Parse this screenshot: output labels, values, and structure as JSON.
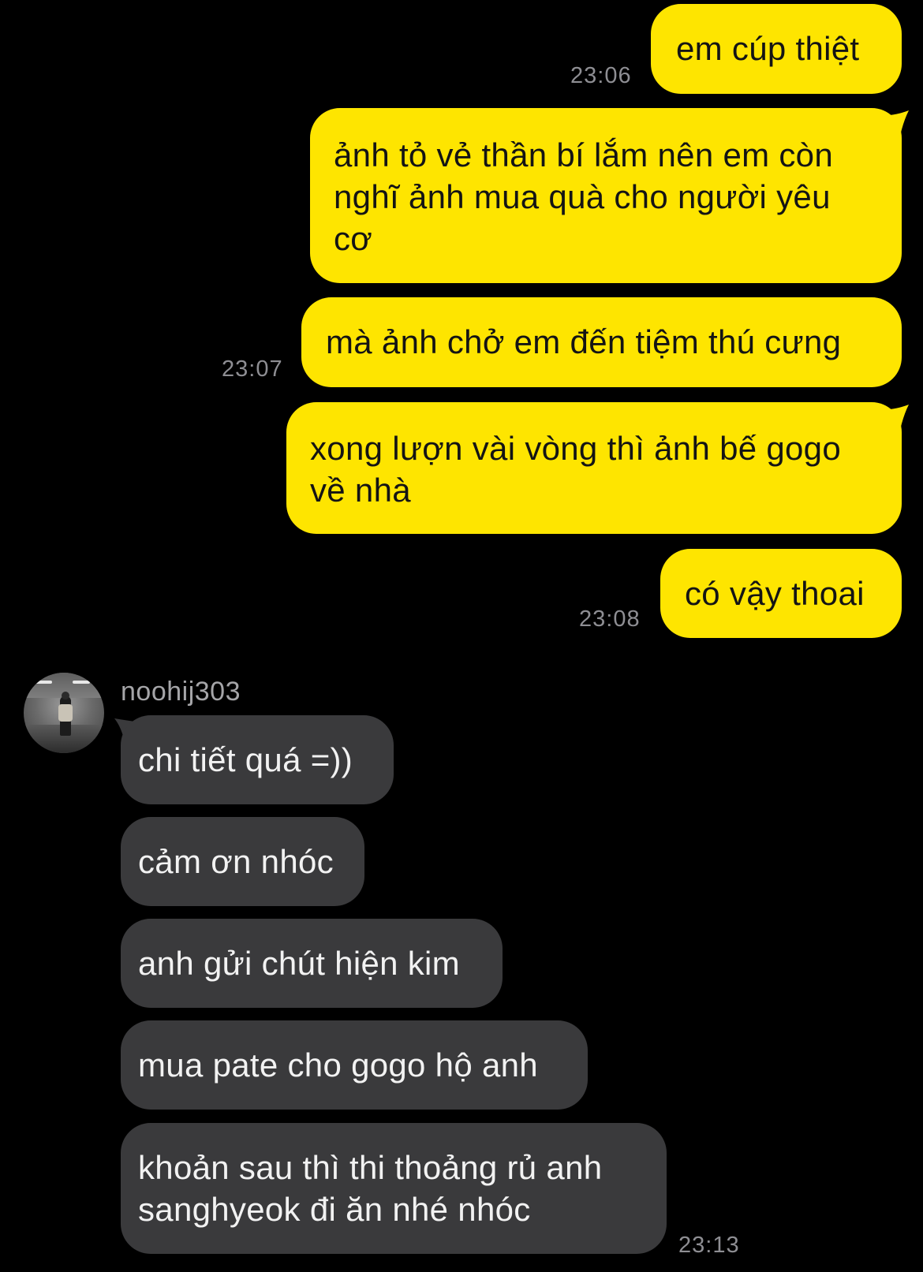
{
  "conversation": {
    "outgoing": [
      {
        "text_lines": [
          "em cúp thiệt"
        ],
        "time": "23:06"
      },
      {
        "text_lines": [
          "ảnh tỏ vẻ thần bí lắm nên em còn",
          "nghĩ ảnh mua quà cho người yêu",
          "cơ"
        ],
        "time": ""
      },
      {
        "text_lines": [
          "mà ảnh chở em đến tiệm thú cưng"
        ],
        "time": "23:07"
      },
      {
        "text_lines": [
          "xong lượn vài vòng thì ảnh bế gogo",
          "về nhà"
        ],
        "time": ""
      },
      {
        "text_lines": [
          "có vậy thoai"
        ],
        "time": "23:08"
      }
    ],
    "incoming_sender": {
      "name": "noohij303",
      "avatar_icon": "profile-photo"
    },
    "incoming": [
      {
        "text_lines": [
          "chi tiết quá =))"
        ],
        "time": ""
      },
      {
        "text_lines": [
          "cảm ơn nhóc"
        ],
        "time": ""
      },
      {
        "text_lines": [
          "anh gửi chút hiện kim"
        ],
        "time": ""
      },
      {
        "text_lines": [
          "mua pate cho gogo hộ anh"
        ],
        "time": ""
      },
      {
        "text_lines": [
          "khoản sau thì thi thoảng rủ anh",
          "sanghyeok đi ăn nhé nhóc"
        ],
        "time": "23:13"
      }
    ]
  },
  "colors": {
    "background": "#000000",
    "outgoing_bubble": "#FEE500",
    "outgoing_text": "#141414",
    "incoming_bubble": "#3A3A3C",
    "incoming_text": "#F2F2F2",
    "timestamp": "#8E8E93",
    "sender_name": "#A5A5A8"
  }
}
